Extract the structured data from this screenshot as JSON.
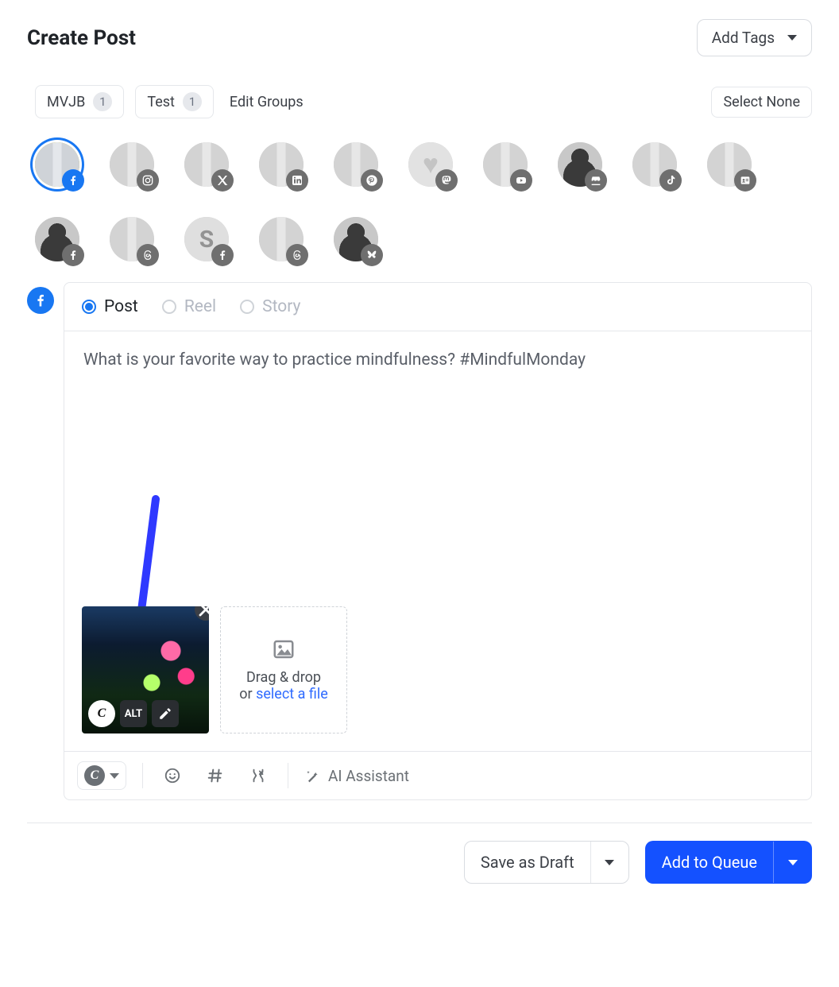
{
  "header": {
    "title": "Create Post",
    "add_tags": "Add Tags"
  },
  "groups": {
    "items": [
      {
        "label": "MVJB",
        "count": "1"
      },
      {
        "label": "Test",
        "count": "1"
      }
    ],
    "edit": "Edit Groups",
    "select_none": "Select None"
  },
  "accounts": [
    {
      "name": "facebook-page",
      "network": "facebook",
      "selected": true,
      "style": "legs"
    },
    {
      "name": "instagram",
      "network": "instagram",
      "selected": false,
      "style": "legs"
    },
    {
      "name": "twitter-x",
      "network": "x",
      "selected": false,
      "style": "legs"
    },
    {
      "name": "linkedin",
      "network": "linkedin",
      "selected": false,
      "style": "legs"
    },
    {
      "name": "pinterest",
      "network": "pinterest",
      "selected": false,
      "style": "legs"
    },
    {
      "name": "mastodon",
      "network": "mastodon",
      "selected": false,
      "style": "heart"
    },
    {
      "name": "youtube",
      "network": "youtube",
      "selected": false,
      "style": "legs"
    },
    {
      "name": "google-business",
      "network": "gmb",
      "selected": false,
      "style": "silhouette"
    },
    {
      "name": "tiktok",
      "network": "tiktok",
      "selected": false,
      "style": "legs"
    },
    {
      "name": "contact-card",
      "network": "card",
      "selected": false,
      "style": "legs"
    },
    {
      "name": "facebook-profile",
      "network": "facebook",
      "selected": false,
      "style": "silhouette"
    },
    {
      "name": "threads",
      "network": "threads",
      "selected": false,
      "style": "legs"
    },
    {
      "name": "facebook-s",
      "network": "facebook",
      "selected": false,
      "style": "sletter"
    },
    {
      "name": "threads-2",
      "network": "threads",
      "selected": false,
      "style": "legs"
    },
    {
      "name": "bluesky",
      "network": "bluesky",
      "selected": false,
      "style": "silhouette"
    }
  ],
  "post_types": {
    "post": "Post",
    "reel": "Reel",
    "story": "Story",
    "active": "post"
  },
  "compose": {
    "text": "What is your favorite way to practice mindfulness? #MindfulMonday"
  },
  "media": {
    "alt_label": "ALT",
    "drop_label_1": "Drag & drop",
    "drop_label_2": "or ",
    "drop_link": "select a file"
  },
  "toolbar": {
    "ai_label": "AI Assistant"
  },
  "footer": {
    "draft": "Save as Draft",
    "queue": "Add to Queue"
  },
  "annotation": {
    "arrow_color": "#2f39ff"
  }
}
